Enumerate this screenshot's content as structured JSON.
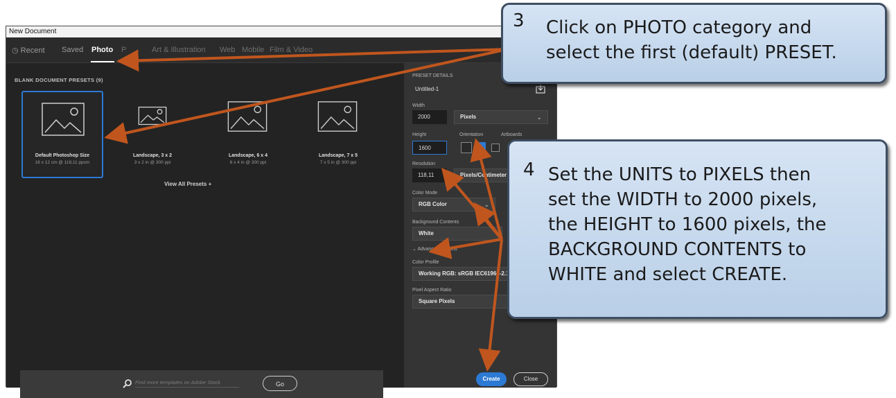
{
  "window": {
    "title": "New Document",
    "tabs": [
      {
        "label": "Recent",
        "icon": "clock-icon",
        "active": false
      },
      {
        "label": "Saved",
        "active": false
      },
      {
        "label": "Photo",
        "active": true
      },
      {
        "label": "P",
        "active": false
      },
      {
        "label": "Art & Illustration",
        "active": false
      },
      {
        "label": "Web",
        "active": false
      },
      {
        "label": "Mobile",
        "active": false
      },
      {
        "label": "Film & Video",
        "active": false
      }
    ]
  },
  "presets": {
    "heading": "BLANK DOCUMENT PRESETS (9)",
    "items": [
      {
        "name": "Default Photoshop Size",
        "size": "16 x 12 cm @ 118,11 ppcm",
        "selected": true
      },
      {
        "name": "Landscape, 3 x 2",
        "size": "3 x 2 in @ 300 ppi",
        "selected": false
      },
      {
        "name": "Landscape, 6 x 4",
        "size": "6 x 4 in @ 300 ppi",
        "selected": false
      },
      {
        "name": "Landscape, 7 x 5",
        "size": "7 x 5 in @ 300 ppi",
        "selected": false
      }
    ],
    "view_all": "View All Presets +"
  },
  "stock": {
    "placeholder": "Find more templates on Adobe Stock",
    "go_label": "Go"
  },
  "details": {
    "heading": "PRESET DETAILS",
    "doc_name": "Untitled-1",
    "width_label": "Width",
    "width_value": "2000",
    "units": "Pixels",
    "height_label": "Height",
    "height_value": "1600",
    "orientation_label": "Orientation",
    "artboards_label": "Artboards",
    "resolution_label": "Resolution",
    "resolution_value": "118,11",
    "resolution_units": "Pixels/Centimeter",
    "color_mode_label": "Color Mode",
    "color_mode": "RGB Color",
    "bg_label": "Background Contents",
    "bg_value": "White",
    "advanced_label": "Advanced Options",
    "profile_label": "Color Profile",
    "profile_value": "Working RGB: sRGB IEC61966-2.1",
    "pixel_ratio_label": "Pixel Aspect Ratio",
    "pixel_ratio_value": "Square Pixels",
    "create_label": "Create",
    "close_label": "Close"
  },
  "callouts": {
    "step3": {
      "number": "3",
      "lines": [
        "Click on PHOTO category and",
        "select the first (default) PRESET."
      ]
    },
    "step4": {
      "number": "4",
      "lines": [
        "Set the UNITS to PIXELS then",
        "set the WIDTH to 2000 pixels,",
        "the HEIGHT to 1600 pixels, the",
        "BACKGROUND CONTENTS to",
        "WHITE and select CREATE."
      ]
    }
  },
  "colors": {
    "accent": "#2d7ad4",
    "arrow": "#c0561e",
    "callout_border": "#3e4e63"
  }
}
